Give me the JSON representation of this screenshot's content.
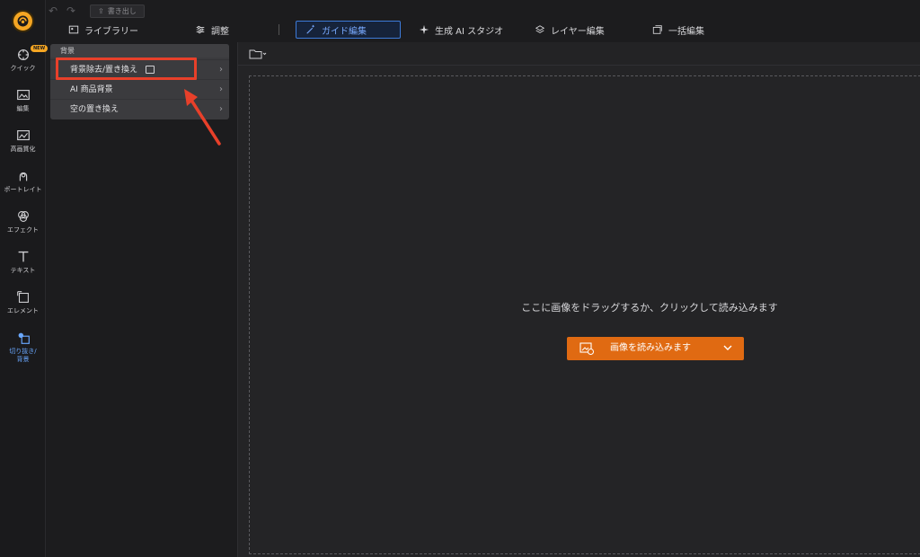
{
  "toolbar": {
    "export_label": "書き出し"
  },
  "rail": {
    "new_badge": "NEW",
    "items": [
      {
        "label": "クイック"
      },
      {
        "label": "編集"
      },
      {
        "label": "高画質化"
      },
      {
        "label": "ポートレイト"
      },
      {
        "label": "エフェクト"
      },
      {
        "label": "テキスト"
      },
      {
        "label": "エレメント"
      },
      {
        "label": "切り抜き/",
        "label2": "背景"
      }
    ]
  },
  "tabs": [
    {
      "label": "ライブラリー"
    },
    {
      "label": "調整"
    },
    {
      "label": "ガイド編集"
    },
    {
      "label": "生成 AI スタジオ"
    },
    {
      "label": "レイヤー編集"
    },
    {
      "label": "一括編集"
    }
  ],
  "panel": {
    "header": "背景",
    "items": [
      {
        "label": "背景除去/置き換え"
      },
      {
        "label": "AI 商品背景"
      },
      {
        "label": "空の置き換え"
      }
    ]
  },
  "workspace": {
    "drop_text": "ここに画像をドラッグするか、クリックして読み込みます",
    "load_button": "画像を読み込みます"
  },
  "colors": {
    "accent": "#3d7ad8",
    "button": "#e06a12",
    "highlight": "#e8402a"
  }
}
